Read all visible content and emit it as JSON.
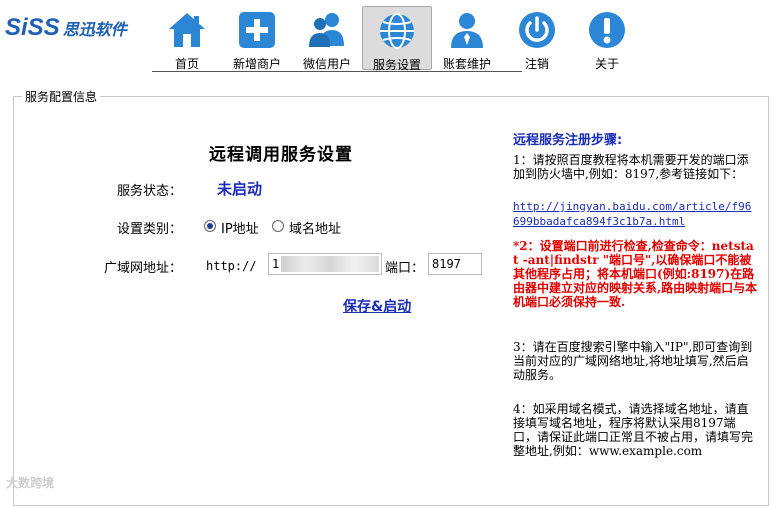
{
  "logo": {
    "mark": "SiSS",
    "cn": "思迅软件"
  },
  "nav": [
    {
      "label": "首页",
      "icon": "home-icon"
    },
    {
      "label": "新增商户",
      "icon": "plus-icon"
    },
    {
      "label": "微信用户",
      "icon": "users-icon"
    },
    {
      "label": "服务设置",
      "icon": "globe-icon",
      "active": true
    },
    {
      "label": "账套维护",
      "icon": "user-icon"
    },
    {
      "label": "注销",
      "icon": "power-icon"
    },
    {
      "label": "关于",
      "icon": "info-icon"
    }
  ],
  "panel": {
    "legend": "服务配置信息"
  },
  "form": {
    "title": "远程调用服务设置",
    "status_label": "服务状态：",
    "status_value": "未启动",
    "type_label": "设置类别：",
    "type_options": [
      "IP地址",
      "域名地址"
    ],
    "type_selected": "IP地址",
    "wan_label": "广域网地址：",
    "wan_prefix": "http://",
    "wan_value": "1",
    "port_label": "端口：",
    "port_value": "8197",
    "save_label": "保存&启动"
  },
  "steps": {
    "title": "远程服务注册步骤:",
    "s1": "1：请按照百度教程将本机需要开发的端口添加到防火墙中,例如：8197,参考链接如下：",
    "s1_link": "http://jingyan.baidu.com/article/f96699bbadafca894f3c1b7a.html",
    "s2": "*2：设置端口前进行检查,检查命令：netstat -ant|findstr \"端口号\",以确保端口不能被其他程序占用；将本机端口(例如:8197)在路由器中建立对应的映射关系,路由映射端口与本机端口必须保持一致.",
    "s3": "3：请在百度搜索引擎中输入\"IP\",即可查询到当前对应的广域网络地址,将地址填写,然后启动服务。",
    "s4": "4：如采用域名模式，请选择域名地址，请直接填写域名地址，程序将默认采用8197端口，请保证此端口正常且不被占用，请填写完整地址,例如：www.example.com"
  },
  "watermark": "大数跨境",
  "colors": {
    "brand": "#1f5fb4",
    "link": "#1a2db7",
    "warning": "#e10000"
  }
}
